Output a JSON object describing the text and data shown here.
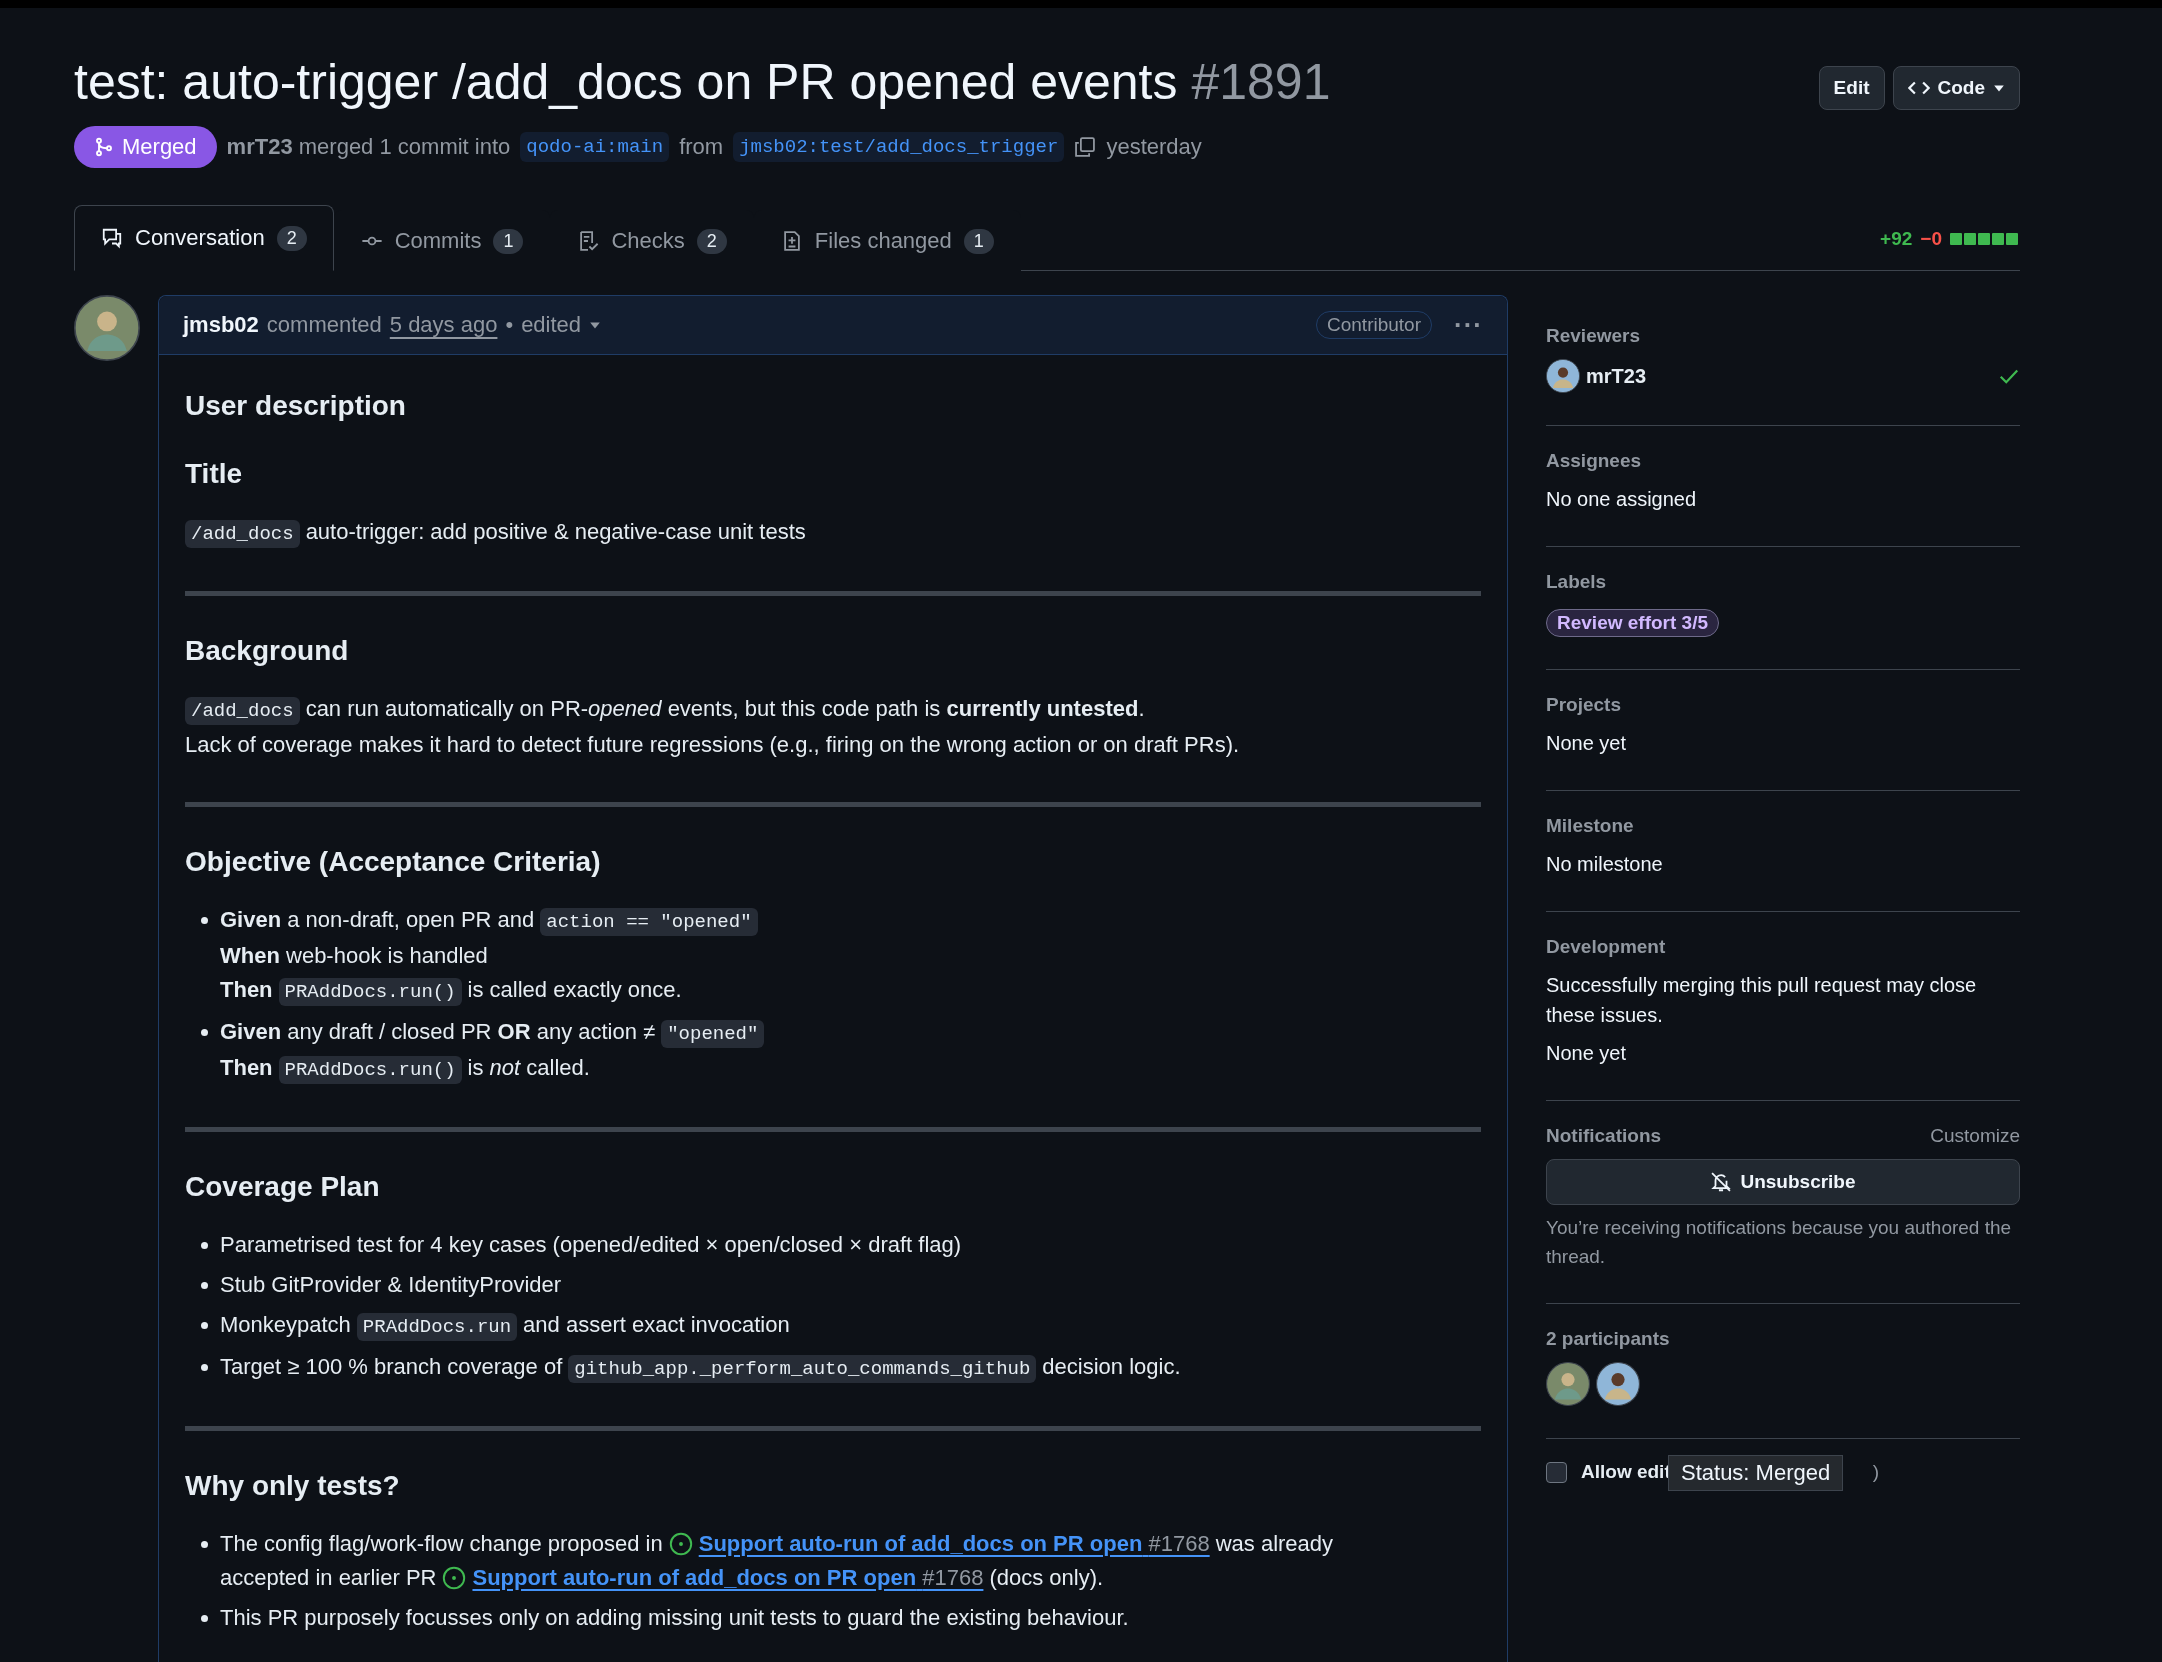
{
  "header": {
    "title": "test: auto-trigger /add_docs on PR opened events",
    "number": "#1891",
    "edit_button": "Edit",
    "code_button": "Code",
    "status": "Merged",
    "author": "mrT23",
    "action": "merged 1 commit into",
    "base_branch": "qodo-ai:main",
    "from": "from",
    "head_branch": "jmsb02:test/add_docs_trigger",
    "time": "yesterday"
  },
  "tabs": [
    {
      "label": "Conversation",
      "count": "2",
      "selected": true
    },
    {
      "label": "Commits",
      "count": "1",
      "selected": false
    },
    {
      "label": "Checks",
      "count": "2",
      "selected": false
    },
    {
      "label": "Files changed",
      "count": "1",
      "selected": false
    }
  ],
  "diffstat": {
    "added": "+92",
    "removed": "−0"
  },
  "comment": {
    "author": "jmsb02",
    "action": "commented",
    "time": "5 days ago",
    "separator": "•",
    "edited": "edited",
    "role": "Contributor",
    "menu": "···",
    "body": [
      {
        "kind": "h2",
        "text": "User description"
      },
      {
        "kind": "h3",
        "text": "Title"
      },
      {
        "kind": "p",
        "lines": [
          [
            {
              "kind": "code",
              "text": "/add_docs"
            },
            {
              "kind": "text",
              "text": "auto-trigger: add positive & negative-case unit tests"
            }
          ]
        ]
      },
      {
        "kind": "rule"
      },
      {
        "kind": "h3",
        "text": "Background"
      },
      {
        "kind": "p",
        "lines": [
          [
            {
              "kind": "code",
              "text": "/add_docs"
            },
            {
              "kind": "text",
              "text": "can run automatically on PR-*opened* events, but this code path is **currently untested**."
            }
          ],
          [
            {
              "kind": "text",
              "text": "Lack of coverage makes it hard to detect future regressions (e.g., firing on the wrong action or on draft PRs)."
            }
          ]
        ]
      },
      {
        "kind": "rule"
      },
      {
        "kind": "h3",
        "text": "Objective (Acceptance Criteria)"
      },
      {
        "kind": "list",
        "items": [
          [
            [
              {
                "kind": "text",
                "text": "**Given** a non-draft, open PR and"
              },
              {
                "kind": "code",
                "text": "action == \"opened\""
              }
            ],
            [
              {
                "kind": "text",
                "text": "**When** web-hook is handled"
              }
            ],
            [
              {
                "kind": "text",
                "text": "**Then**"
              },
              {
                "kind": "code",
                "text": "PRAddDocs.run()"
              },
              {
                "kind": "text",
                "text": "is called exactly once."
              }
            ]
          ],
          [
            [
              {
                "kind": "text",
                "text": "**Given** any draft / closed PR **OR** any action ≠"
              },
              {
                "kind": "code",
                "text": "\"opened\""
              }
            ],
            [
              {
                "kind": "text",
                "text": "**Then**"
              },
              {
                "kind": "code",
                "text": "PRAddDocs.run()"
              },
              {
                "kind": "text",
                "text": "is *not* called."
              }
            ]
          ]
        ]
      },
      {
        "kind": "rule"
      },
      {
        "kind": "h3",
        "text": "Coverage Plan"
      },
      {
        "kind": "list",
        "items": [
          [
            [
              {
                "kind": "text",
                "text": "Parametrised test for 4 key cases (opened/edited × open/closed × draft flag)"
              }
            ]
          ],
          [
            [
              {
                "kind": "text",
                "text": "Stub GitProvider & IdentityProvider"
              }
            ]
          ],
          [
            [
              {
                "kind": "text",
                "text": "Monkeypatch"
              },
              {
                "kind": "code",
                "text": "PRAddDocs.run"
              },
              {
                "kind": "text",
                "text": "and assert exact invocation"
              }
            ]
          ],
          [
            [
              {
                "kind": "text",
                "text": "Target ≥ 100 % branch coverage of"
              },
              {
                "kind": "code",
                "text": "github_app._perform_auto_commands_github"
              },
              {
                "kind": "text",
                "text": "decision logic."
              }
            ]
          ]
        ]
      },
      {
        "kind": "rule"
      },
      {
        "kind": "h3",
        "text": "Why only tests?"
      },
      {
        "kind": "list",
        "items": [
          [
            [
              {
                "kind": "text",
                "text": "The config flag/work-flow change proposed in"
              },
              {
                "kind": "link",
                "text": "Support auto-run of add_docs on PR open",
                "number": "#1768"
              },
              {
                "kind": "text",
                "text": "was already"
              }
            ],
            [
              {
                "kind": "text",
                "text": "accepted in earlier PR"
              },
              {
                "kind": "link",
                "text": "Support auto-run of add_docs on PR open",
                "number": "#1768"
              },
              {
                "kind": "text",
                "text": "(docs only)."
              }
            ]
          ],
          [
            [
              {
                "kind": "text",
                "text": "This PR purposely focusses only on adding missing unit tests to guard the existing behaviour."
              }
            ]
          ]
        ]
      }
    ]
  },
  "sidebar": {
    "sections": [
      {
        "kind": "reviewers",
        "title": "Reviewers",
        "name": "mrT23",
        "approved": true
      },
      {
        "kind": "plain",
        "title": "Assignees",
        "lines": [
          "No one assigned"
        ]
      },
      {
        "kind": "labels",
        "title": "Labels",
        "label": "Review effort 3/5"
      },
      {
        "kind": "plain",
        "title": "Projects",
        "lines": [
          "None yet"
        ]
      },
      {
        "kind": "plain",
        "title": "Milestone",
        "lines": [
          "No milestone"
        ]
      },
      {
        "kind": "plain",
        "title": "Development",
        "lines": [
          "Successfully merging this pull request may close these issues.",
          "None yet"
        ]
      },
      {
        "kind": "notifications",
        "title": "Notifications",
        "action": "Customize",
        "button": "Unsubscribe",
        "note": "You’re receiving notifications because you authored the thread."
      },
      {
        "kind": "participants",
        "title": "2 participants"
      }
    ],
    "allow_edits": {
      "label": "Allow edit",
      "tail": ")",
      "checked": false
    },
    "tooltip": "Status: Merged"
  }
}
